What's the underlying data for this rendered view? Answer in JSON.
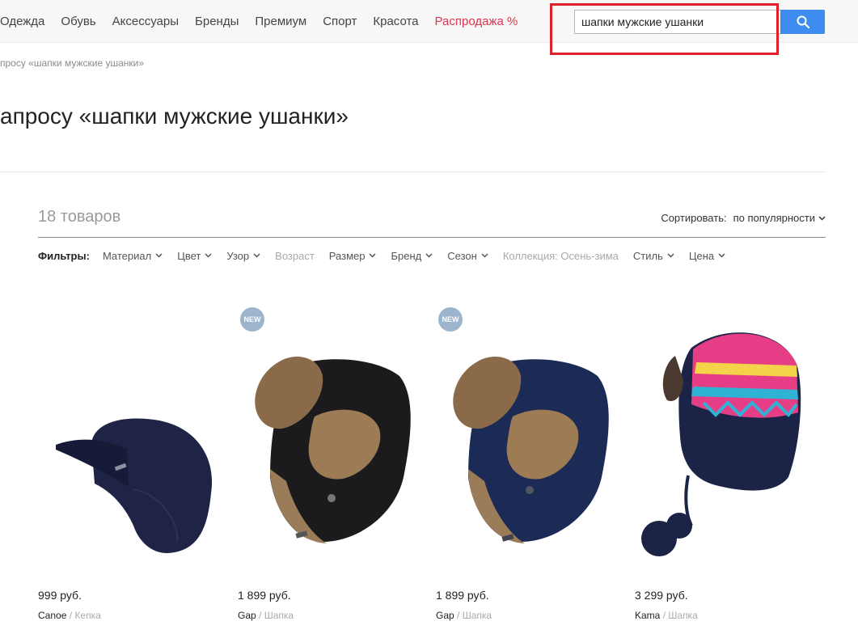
{
  "nav": {
    "items": [
      {
        "label": "Одежда",
        "sale": false
      },
      {
        "label": "Обувь",
        "sale": false
      },
      {
        "label": "Аксессуары",
        "sale": false
      },
      {
        "label": "Бренды",
        "sale": false
      },
      {
        "label": "Премиум",
        "sale": false
      },
      {
        "label": "Спорт",
        "sale": false
      },
      {
        "label": "Красота",
        "sale": false
      },
      {
        "label": "Распродажа %",
        "sale": true
      }
    ]
  },
  "search": {
    "value": "шапки мужские ушанки",
    "icon": "search-icon"
  },
  "breadcrumb": "просу «шапки мужские ушанки»",
  "page_title": "апросу «шапки мужские ушанки»",
  "results": {
    "count_label": "18 товаров",
    "sort_label": "Сортировать:",
    "sort_value": "по популярности"
  },
  "filters": {
    "label": "Фильтры:",
    "items": [
      {
        "label": "Материал",
        "enabled": true
      },
      {
        "label": "Цвет",
        "enabled": true
      },
      {
        "label": "Узор",
        "enabled": true
      },
      {
        "label": "Возраст",
        "enabled": false
      },
      {
        "label": "Размер",
        "enabled": true
      },
      {
        "label": "Бренд",
        "enabled": true
      },
      {
        "label": "Сезон",
        "enabled": true
      },
      {
        "label": "Коллекция: Осень-зима",
        "enabled": false
      },
      {
        "label": "Стиль",
        "enabled": true
      },
      {
        "label": "Цена",
        "enabled": true
      }
    ]
  },
  "products": [
    {
      "price": "999 руб.",
      "brand": "Canoe",
      "separator": "/",
      "type": "Кепка",
      "badge": ""
    },
    {
      "price": "1 899 руб.",
      "brand": "Gap",
      "separator": "/",
      "type": "Шапка",
      "badge": "NEW"
    },
    {
      "price": "1 899 руб.",
      "brand": "Gap",
      "separator": "/",
      "type": "Шапка",
      "badge": "NEW"
    },
    {
      "price": "3 299 руб.",
      "brand": "Kama",
      "separator": "/",
      "type": "Шапка",
      "badge": ""
    }
  ],
  "colors": {
    "sale": "#e3334f",
    "search_button": "#3f8cf0",
    "highlight": "#e2202a",
    "badge": "#9cb4cc"
  }
}
